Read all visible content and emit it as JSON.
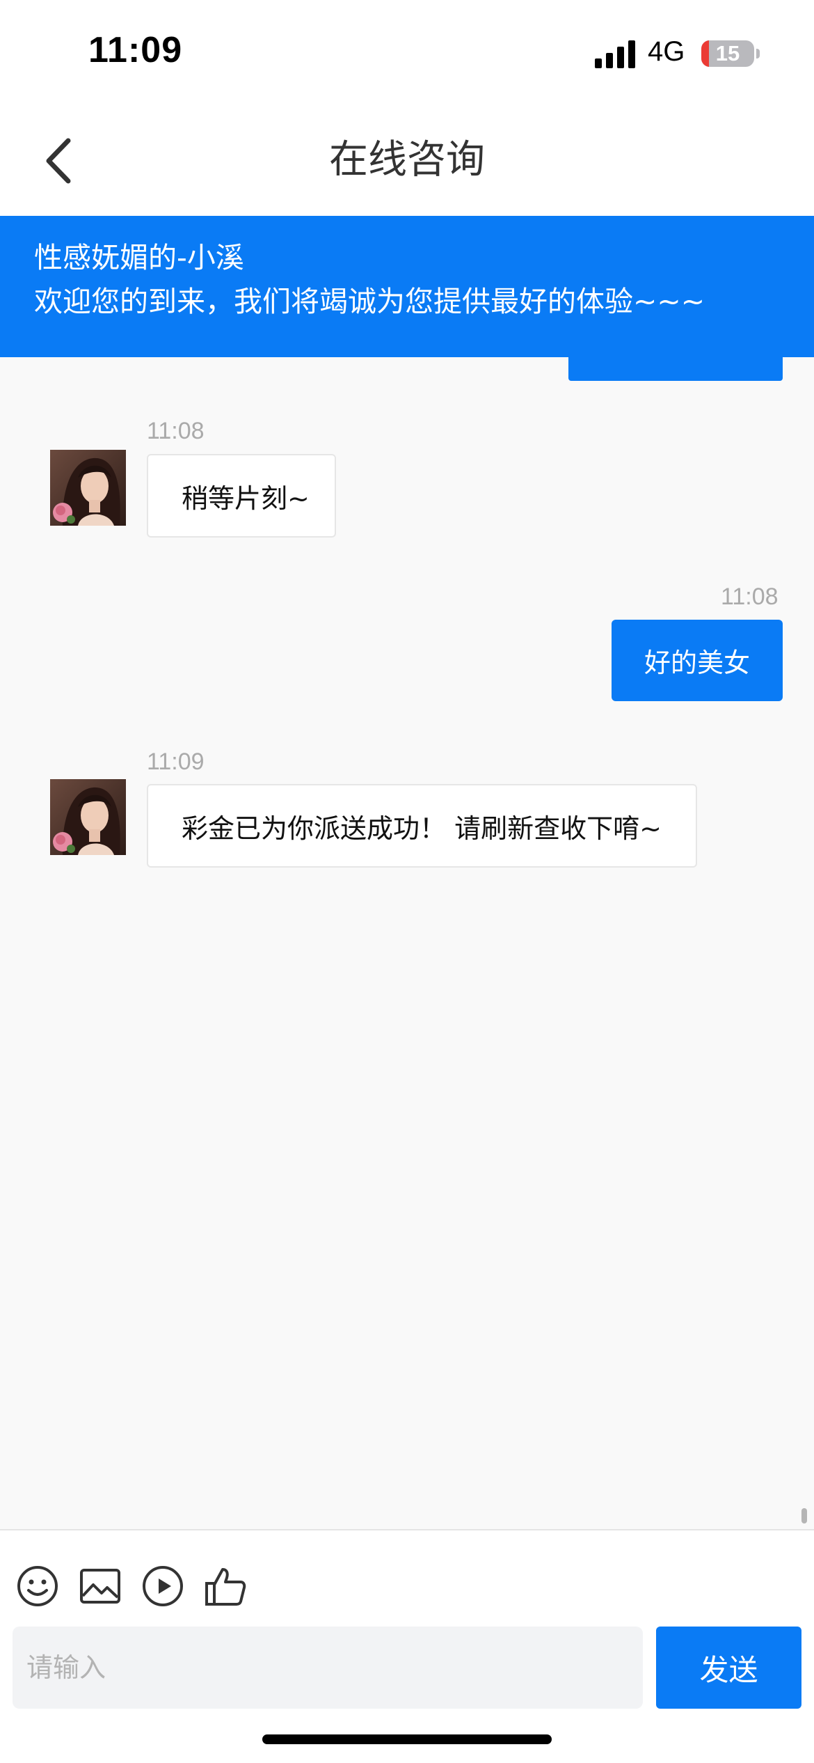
{
  "status_bar": {
    "time": "11:09",
    "network": "4G",
    "battery_level": "15",
    "battery_fraction": 0.15
  },
  "nav": {
    "title": "在线咨询",
    "back_icon": "chevron-left-icon"
  },
  "notice": {
    "agent_name": "性感妩媚的-小溪",
    "welcome_text": "欢迎您的到来，我们将竭诚为您提供最好的体验~~~"
  },
  "messages": [
    {
      "direction": "incoming",
      "time": "11:08",
      "text": "稍等片刻~"
    },
    {
      "direction": "outgoing",
      "time": "11:08",
      "text": "好的美女"
    },
    {
      "direction": "incoming",
      "time": "11:09",
      "text": "彩金已为你派送成功！ 请刷新查收下唷~"
    }
  ],
  "toolbar": {
    "icons": [
      "emoji-icon",
      "image-icon",
      "video-icon",
      "thumbs-up-icon"
    ]
  },
  "composer": {
    "placeholder": "请输入",
    "value": "",
    "send_label": "发送"
  },
  "colors": {
    "accent": "#0a7bf5",
    "background": "#f9f9f9",
    "timestamp": "#aaaaaa"
  }
}
